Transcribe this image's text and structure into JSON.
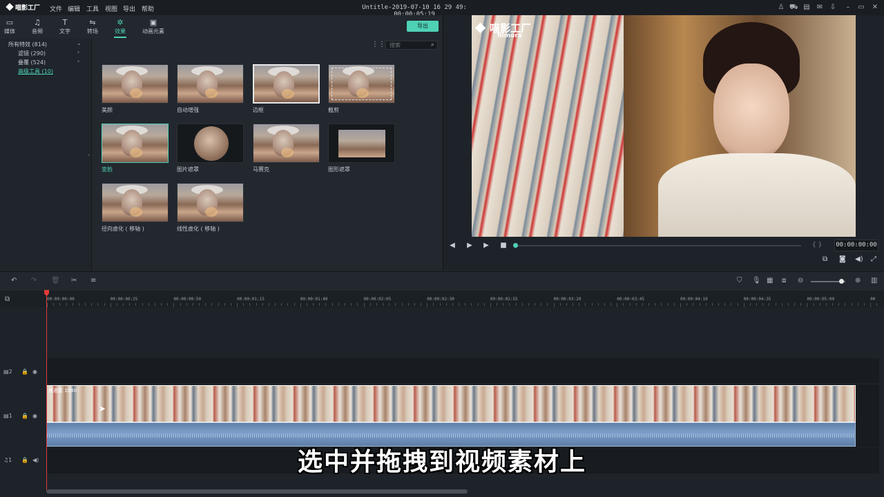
{
  "app": {
    "logo": "喵影工厂",
    "window_title": "Untitle-2019-07-10 16 29 49: 00:00:05:19",
    "menu": [
      "文件",
      "编辑",
      "工具",
      "视图",
      "导出",
      "帮助"
    ]
  },
  "tabs": [
    {
      "icon": "media-icon",
      "glyph": "▭",
      "label": "媒体"
    },
    {
      "icon": "audio-icon",
      "glyph": "♫",
      "label": "音频"
    },
    {
      "icon": "text-icon",
      "glyph": "T",
      "label": "文字"
    },
    {
      "icon": "transition-icon",
      "glyph": "⇋",
      "label": "转场"
    },
    {
      "icon": "effects-icon",
      "glyph": "✲",
      "label": "效果",
      "active": true
    },
    {
      "icon": "elements-icon",
      "glyph": "▣",
      "label": "动画元素"
    }
  ],
  "export_label": "导出",
  "tree": {
    "all": "所有特效 (814)",
    "filters": "滤镜 (290)",
    "overlays": "叠覆 (524)",
    "advanced": "高级工具 (10)"
  },
  "search": {
    "placeholder": "搜索"
  },
  "effects": [
    {
      "label": "美颜"
    },
    {
      "label": "自动增强"
    },
    {
      "label": "边框"
    },
    {
      "label": "截剪"
    },
    {
      "label": "变脸"
    },
    {
      "label": "图片遮罩"
    },
    {
      "label": "马赛克"
    },
    {
      "label": "图形遮罩"
    },
    {
      "label": "径向虚化 ( 移轴 )"
    },
    {
      "label": "线性虚化 ( 移轴 )"
    }
  ],
  "preview": {
    "watermark": "喵影工厂",
    "watermark_sub": "filmora",
    "timecode": "00:00:00:00",
    "brackets": "{ }"
  },
  "ruler_ticks": [
    "00:00:00:00",
    "00:00:00:25",
    "00:00:00:50",
    "00:00:01:15",
    "00:00:01:40",
    "00:00:02:05",
    "00:00:02:30",
    "00:00:02:55",
    "00:00:03:20",
    "00:00:03:45",
    "00:00:04:10",
    "00:00:04:35",
    "00:00:05:00",
    "00"
  ],
  "tracks": {
    "t2": "2",
    "t1": "1",
    "a1": "1"
  },
  "clip_name": "居酒屋 1080",
  "subtitle": "选中并拖拽到视频素材上",
  "colors": {
    "accent": "#4fd1b6",
    "playhead": "#e23a3a"
  }
}
